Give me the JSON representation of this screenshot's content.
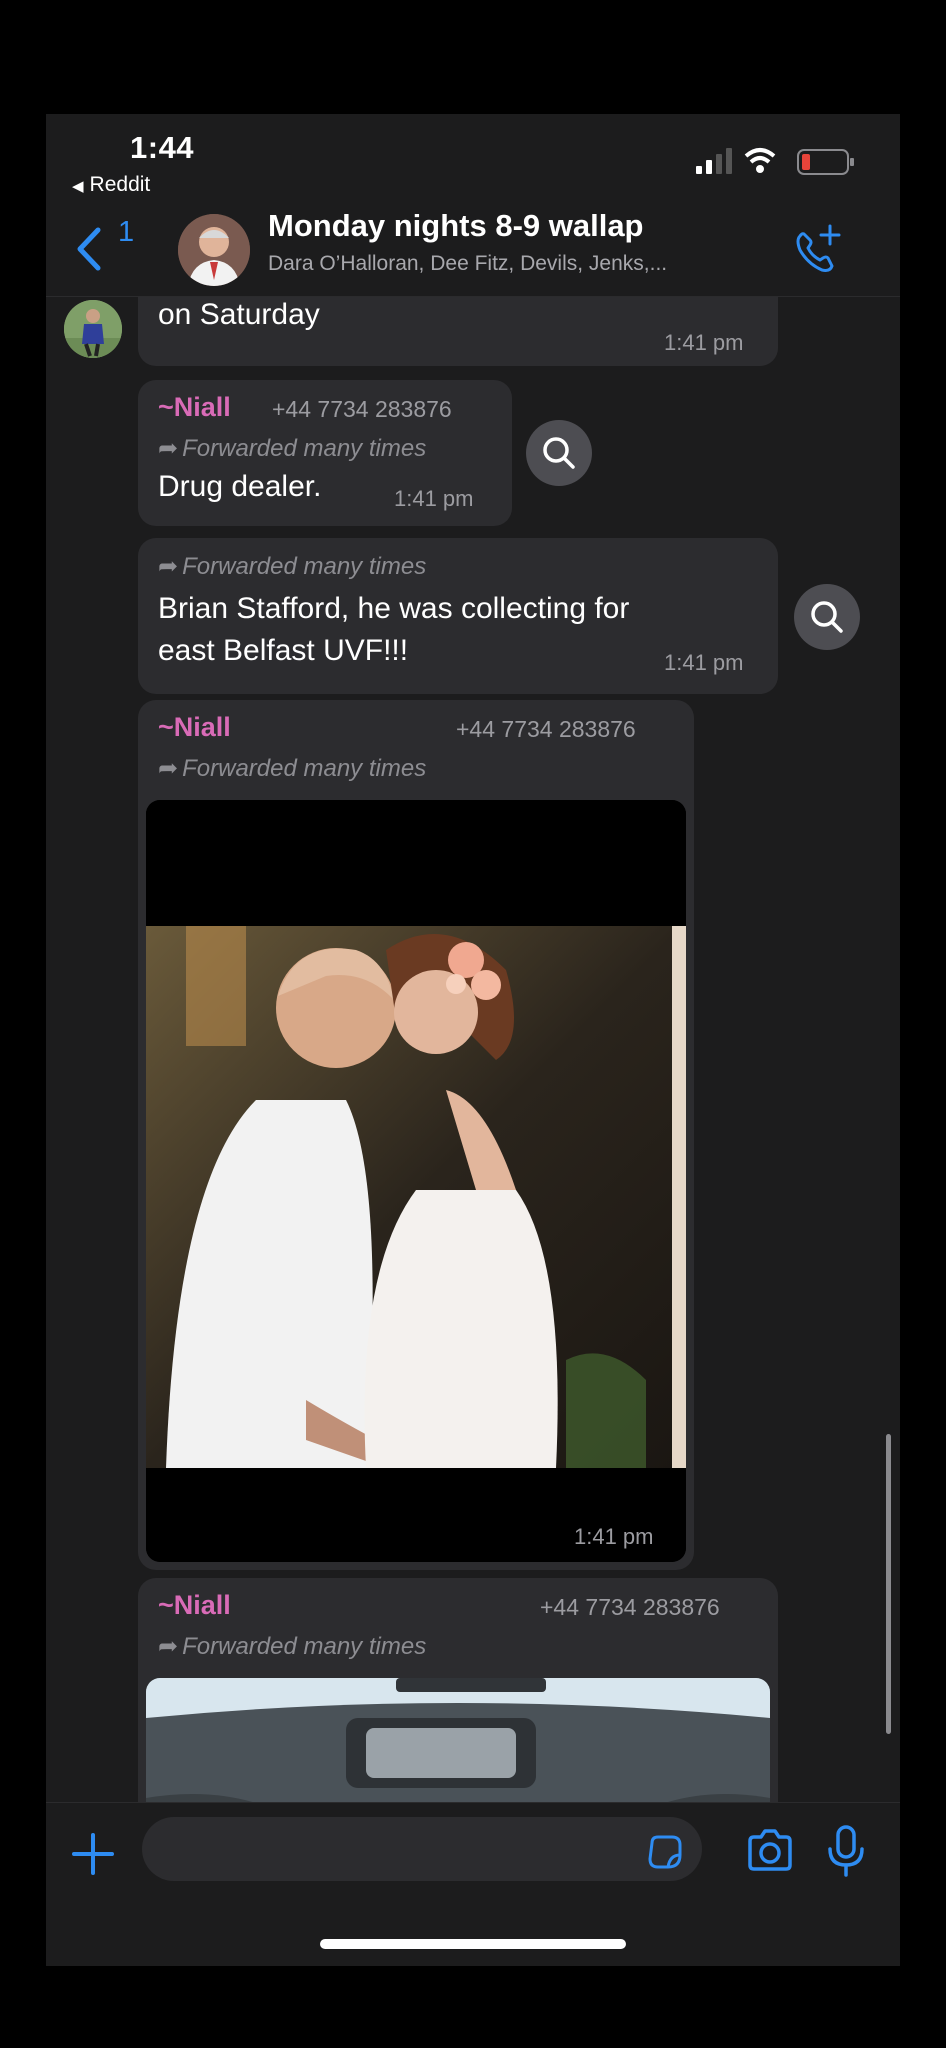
{
  "status_bar": {
    "time": "1:44",
    "back_app": "Reddit"
  },
  "header": {
    "back_count": "1",
    "title": "Monday nights 8-9 wallap",
    "members": "Dara O’Halloran, Dee Fitz, Devils, Jenks,..."
  },
  "messages": [
    {
      "text": "on Saturday",
      "time": "1:41 pm"
    },
    {
      "sender": "~Niall",
      "phone": "+44 7734 283876",
      "forwarded": "Forwarded many times",
      "text": "Drug dealer.",
      "time": "1:41 pm"
    },
    {
      "forwarded": "Forwarded many times",
      "text_line1": "Brian Stafford, he was collecting for",
      "text_line2": "east Belfast UVF!!!",
      "time": "1:41 pm"
    },
    {
      "sender": "~Niall",
      "phone": "+44 7734 283876",
      "forwarded": "Forwarded many times",
      "time": "1:41 pm"
    },
    {
      "sender": "~Niall",
      "phone": "+44 7734 283876",
      "forwarded": "Forwarded many times"
    }
  ],
  "colors": {
    "accent": "#2e8cf2",
    "sender": "#d96bb7",
    "bubble": "#2c2c2f",
    "background": "#1c1c1d"
  },
  "icons": [
    "back-chevron-icon",
    "video-call-add-icon",
    "search-icon",
    "forward-arrow-icon",
    "plus-icon",
    "sticker-icon",
    "camera-icon",
    "microphone-icon"
  ]
}
